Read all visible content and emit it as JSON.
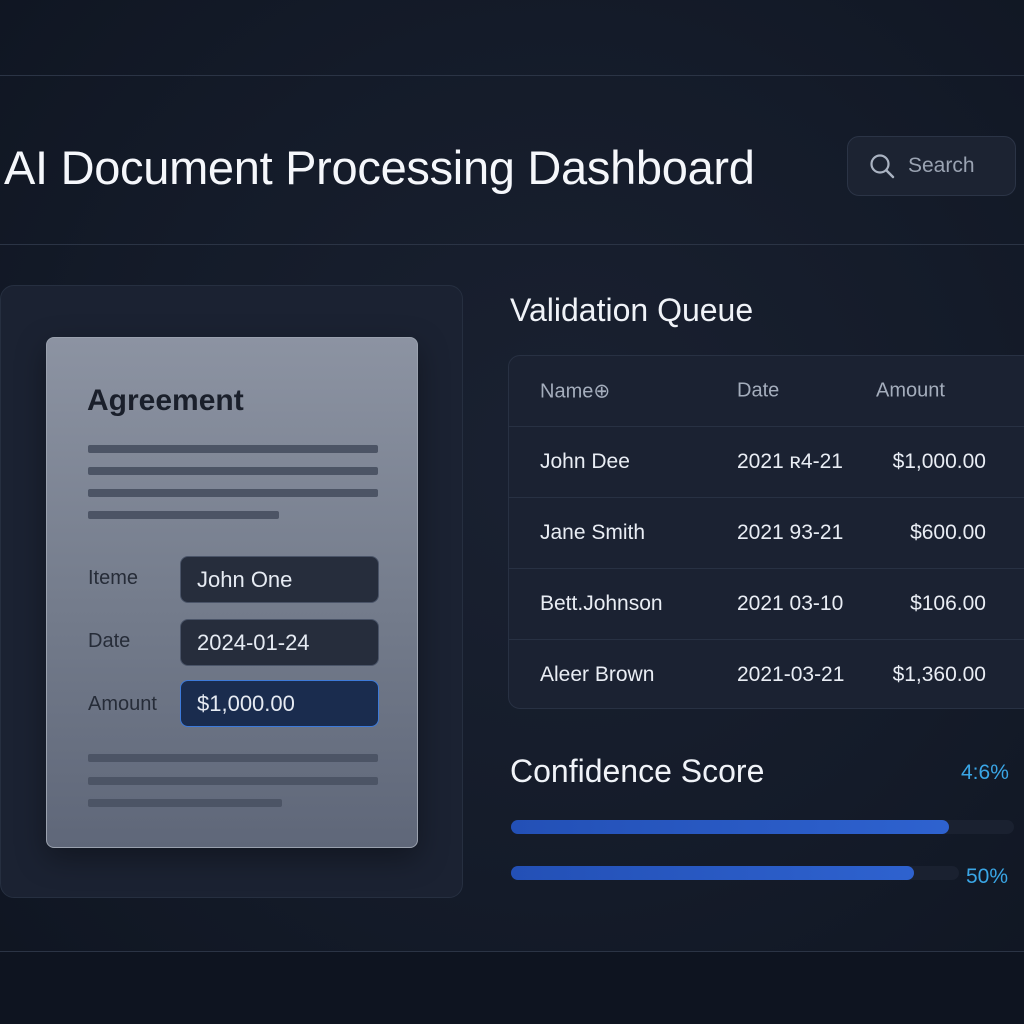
{
  "header": {
    "title": "AI Document Processing Dashboard",
    "search_placeholder": "Search",
    "search_icon": "search-icon"
  },
  "document": {
    "heading": "Agreement",
    "fields": [
      {
        "label": "Iteme",
        "value": "John One"
      },
      {
        "label": "Date",
        "value": "2024-01-24"
      },
      {
        "label": "Amount",
        "value": "$1,000.00"
      }
    ]
  },
  "queue": {
    "title": "Validation Queue",
    "columns": [
      "Name⊕",
      "Date",
      "Amount"
    ],
    "rows": [
      {
        "name": "John Dee",
        "date": "2021 ʀ4-21",
        "amount": "$1,000.00"
      },
      {
        "name": "Jane Smith",
        "date": "2021 93-21",
        "amount": "$600.00"
      },
      {
        "name": "Bett.Johnson",
        "date": "2021 03-10",
        "amount": "$106.00"
      },
      {
        "name": "Aleer Brown",
        "date": "2021-03-21",
        "amount": "$1,360.00"
      }
    ]
  },
  "confidence": {
    "title": "Confidence Score",
    "bars": [
      {
        "label": "4:6%",
        "fill": 0.87
      },
      {
        "label": "50%",
        "fill": 0.9
      }
    ]
  },
  "colors": {
    "background": "#131a28",
    "panel": "#1b2232",
    "accent": "#3aa6e6",
    "bar": "#2858c2"
  }
}
